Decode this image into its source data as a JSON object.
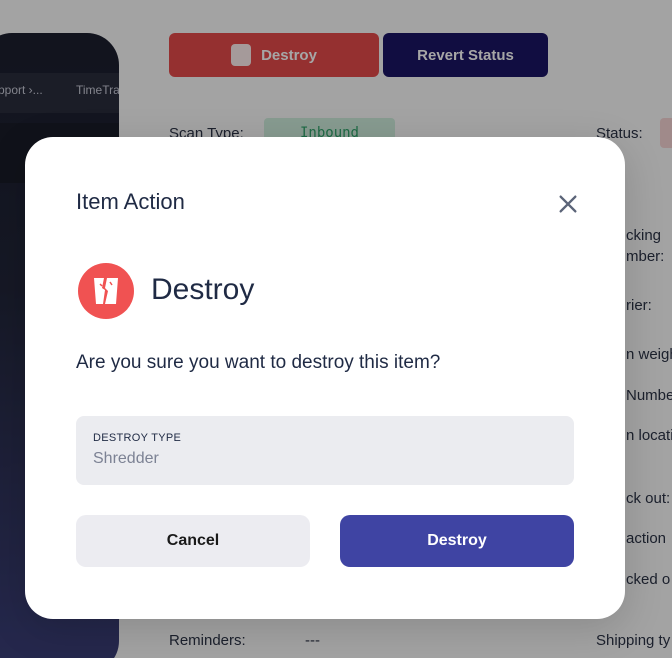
{
  "background": {
    "toolbar": {
      "destroy_label": "Destroy",
      "revert_label": "Revert Status"
    },
    "device": {
      "tab_1": "pport ›...",
      "tab_2": "TimeTrax"
    },
    "fields": {
      "scan_type_label": "Scan Type:",
      "scan_type_value": "Inbound",
      "status_label": "Status:",
      "tracking_label": "cking",
      "number_label": "mber:",
      "carrier_label": "rier:",
      "weight_label": "n weigh",
      "number2_label": "Numbe",
      "location_label": "n locatio",
      "checkout_label": "ck out:",
      "action_label": "action",
      "checked_label": "cked o",
      "reminders_label": "Reminders:",
      "reminders_value": "---",
      "shipping_label": "Shipping ty"
    }
  },
  "modal": {
    "title": "Item Action",
    "action_name": "Destroy",
    "question": "Are you sure you want to destroy this item?",
    "field": {
      "label": "DESTROY TYPE",
      "value": "Shredder"
    },
    "cancel_label": "Cancel",
    "confirm_label": "Destroy"
  },
  "colors": {
    "destroy_red": "#f05252",
    "primary": "#3f44a3",
    "revert_navy": "#1b1464"
  },
  "icons": {
    "close": "close-icon",
    "destroy": "shredded-paper-icon"
  }
}
